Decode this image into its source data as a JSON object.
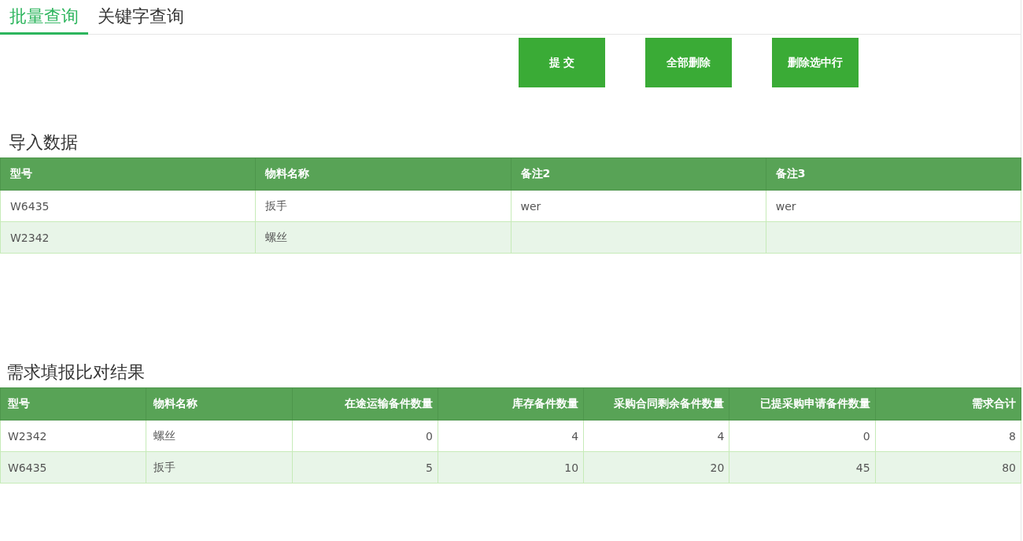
{
  "tabs": [
    {
      "label": "批量查询",
      "selected": true
    },
    {
      "label": "关键字查询",
      "selected": false
    }
  ],
  "buttons": [
    "提 交",
    "全部删除",
    "删除选中行"
  ],
  "import_table": {
    "title": "导入数据",
    "columns": [
      {
        "label": "型号"
      },
      {
        "label": "物料名称"
      },
      {
        "label": "备注2"
      },
      {
        "label": "备注3"
      }
    ],
    "rows": [
      [
        "W6435",
        "扳手",
        "wer",
        "wer"
      ],
      [
        "W2342",
        "螺丝",
        null,
        null
      ]
    ]
  },
  "result_table": {
    "title": "需求填报比对结果",
    "columns": [
      {
        "label": "型号",
        "kind": "text"
      },
      {
        "label": "物料名称",
        "kind": "text"
      },
      {
        "label": "在途运输备件数量",
        "kind": "number"
      },
      {
        "label": "库存备件数量",
        "kind": "number"
      },
      {
        "label": "采购合同剩余备件数量",
        "kind": "number"
      },
      {
        "label": "已提采购申请备件数量",
        "kind": "number"
      },
      {
        "label": "需求合计",
        "kind": "number"
      }
    ],
    "rows": [
      [
        "W2342",
        "螺丝",
        "0",
        "4",
        "4",
        "0",
        "8"
      ],
      [
        "W6435",
        "扳手",
        "5",
        "10",
        "20",
        "45",
        "80"
      ]
    ]
  }
}
